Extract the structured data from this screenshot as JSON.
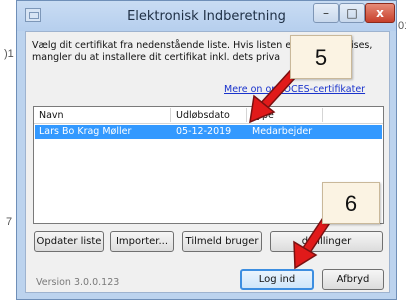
{
  "window": {
    "title": "Elektronisk Indberetning",
    "minimize_glyph": "–",
    "maximize_glyph": "□",
    "close_glyph": "x"
  },
  "description": "Vælg dit certifikat fra nedenstående liste. Hvis listen er to     at ikke vises, mangler du at installere dit certifikat inkl. dets priva",
  "more_info_link": "Mere       on om OCES-certifikater",
  "certificate_list": {
    "columns": [
      "Navn",
      "Udløbsdato",
      "Type"
    ],
    "rows": [
      {
        "navn": "Lars Bo Krag Møller",
        "udlobsdato": "05-12-2019",
        "type": "Medarbejder",
        "selected": true
      }
    ]
  },
  "buttons": {
    "update_list": "Opdater liste",
    "import": "Importer...",
    "register_user": "Tilmeld bruger",
    "settings": "             dstillinger",
    "log_in": "Log ind",
    "cancel": "Afbryd"
  },
  "version": "Version 3.0.0.123",
  "callouts": {
    "step_5": "5",
    "step_6": "6"
  },
  "background_fragments": {
    "left_top": ")1",
    "left_mid": "7",
    "right_top": "01"
  },
  "colors": {
    "selection": "#3399ff",
    "arrow": "#e11a1a",
    "link": "#1a33cc"
  }
}
